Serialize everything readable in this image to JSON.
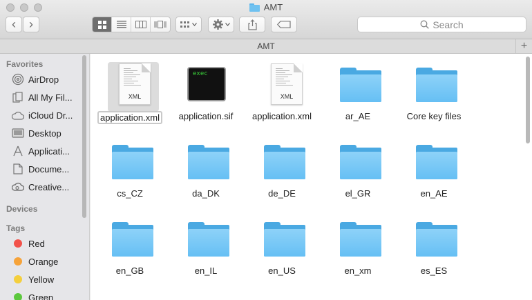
{
  "window": {
    "title": "AMT"
  },
  "toolbar": {
    "back_label": "‹",
    "forward_label": "›",
    "search_placeholder": "Search"
  },
  "pathbar": {
    "label": "AMT",
    "plus_label": "+"
  },
  "sidebar": {
    "favorites_header": "Favorites",
    "favorites": [
      {
        "label": "AirDrop",
        "icon": "airdrop-icon"
      },
      {
        "label": "All My Fil...",
        "icon": "all-files-icon"
      },
      {
        "label": "iCloud Dr...",
        "icon": "cloud-icon"
      },
      {
        "label": "Desktop",
        "icon": "desktop-icon"
      },
      {
        "label": "Applicati...",
        "icon": "applications-icon"
      },
      {
        "label": "Docume...",
        "icon": "documents-icon"
      },
      {
        "label": "Creative...",
        "icon": "creative-cloud-icon"
      }
    ],
    "devices_header": "Devices",
    "tags_header": "Tags",
    "tags": [
      {
        "label": "Red",
        "color": "#f2524a"
      },
      {
        "label": "Orange",
        "color": "#f6a33a"
      },
      {
        "label": "Yellow",
        "color": "#f4cf3d"
      },
      {
        "label": "Green",
        "color": "#5cc83e"
      }
    ]
  },
  "files": [
    {
      "label": "application.xml",
      "kind": "xml",
      "selected": true,
      "ext": "XML"
    },
    {
      "label": "application.sif",
      "kind": "exec",
      "exec_text": "exec"
    },
    {
      "label": "application.xml",
      "kind": "xml",
      "ext": "XML"
    },
    {
      "label": "ar_AE",
      "kind": "folder"
    },
    {
      "label": "Core key files",
      "kind": "folder"
    },
    {
      "label": "cs_CZ",
      "kind": "folder"
    },
    {
      "label": "da_DK",
      "kind": "folder"
    },
    {
      "label": "de_DE",
      "kind": "folder"
    },
    {
      "label": "el_GR",
      "kind": "folder"
    },
    {
      "label": "en_AE",
      "kind": "folder"
    },
    {
      "label": "en_GB",
      "kind": "folder"
    },
    {
      "label": "en_IL",
      "kind": "folder"
    },
    {
      "label": "en_US",
      "kind": "folder"
    },
    {
      "label": "en_xm",
      "kind": "folder"
    },
    {
      "label": "es_ES",
      "kind": "folder"
    }
  ]
}
